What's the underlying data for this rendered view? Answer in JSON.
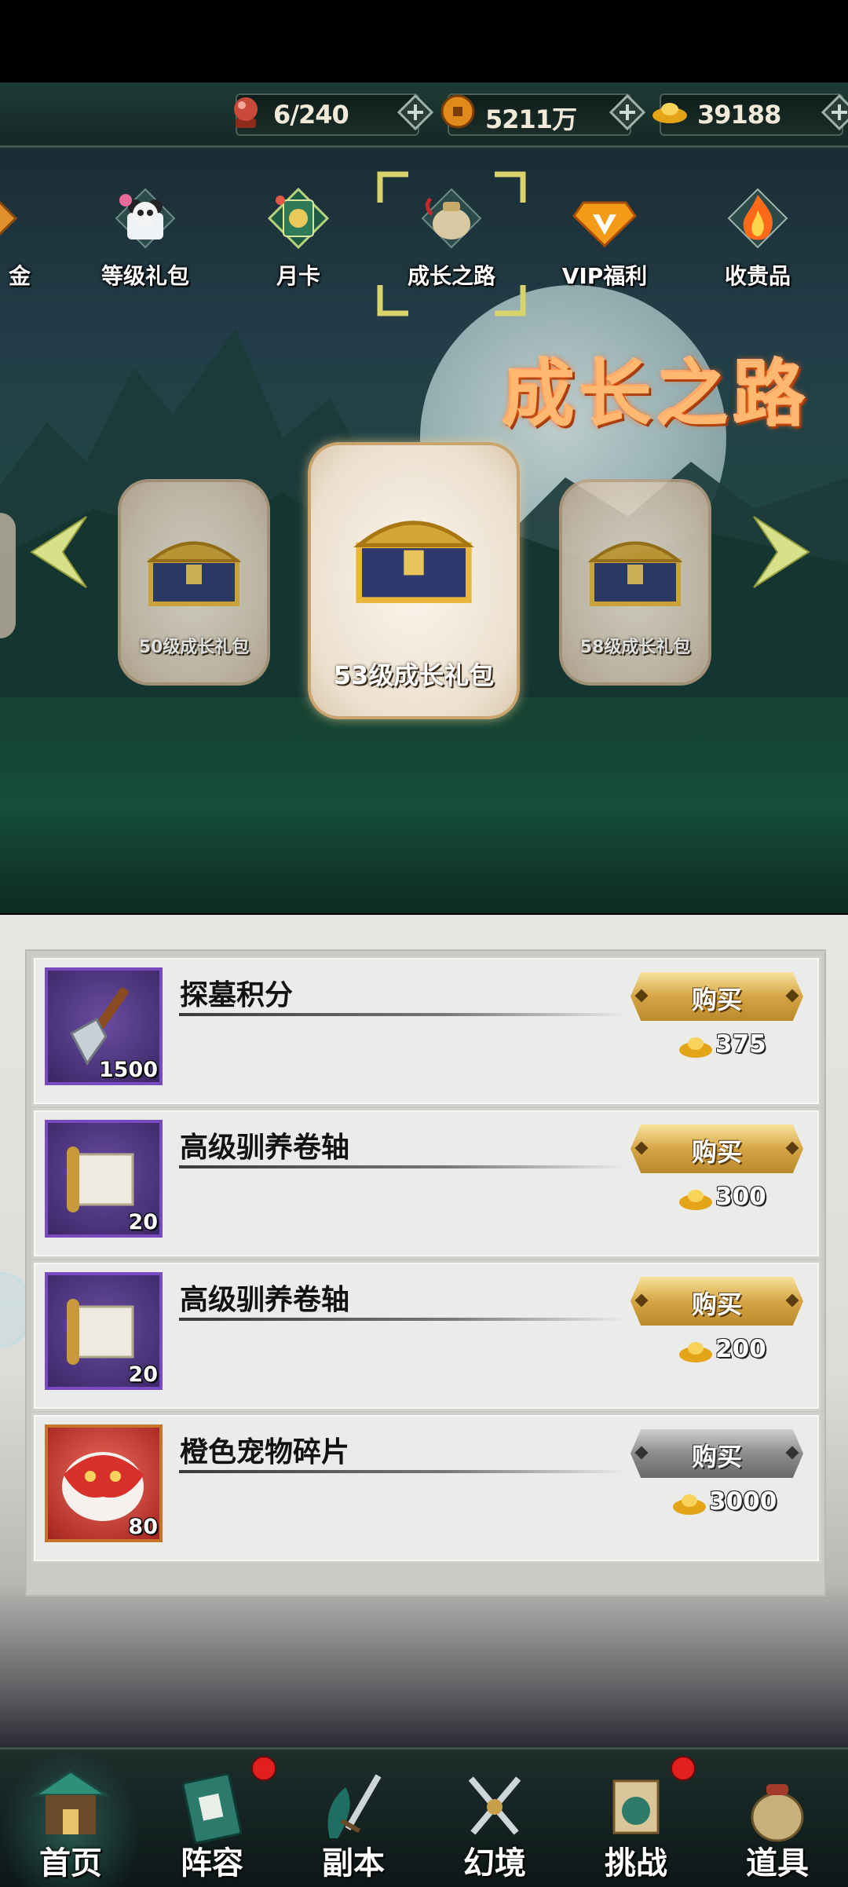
{
  "resources": {
    "stamina": "6/240",
    "copper": "5211万",
    "gold": "39188"
  },
  "tabs": [
    {
      "label": "金",
      "icon": "gold-gift-icon"
    },
    {
      "label": "等级礼包",
      "icon": "level-gift-panda-icon"
    },
    {
      "label": "月卡",
      "icon": "month-card-icon"
    },
    {
      "label": "成长之路",
      "icon": "growth-road-bag-icon",
      "selected": true
    },
    {
      "label": "VIP福利",
      "icon": "vip-gem-icon"
    },
    {
      "label": "收贵品",
      "icon": "collect-treasure-flame-icon"
    }
  ],
  "banner": {
    "title": "成长之路"
  },
  "packs": {
    "left": "50级成长礼包",
    "center": "53级成长礼包",
    "right": "58级成长礼包"
  },
  "shop": {
    "items": [
      {
        "name": "探墓积分",
        "qty": "1500",
        "button": "购买",
        "price": "375",
        "icon": "shovel-icon",
        "button_style": "gold"
      },
      {
        "name": "高级驯养卷轴",
        "qty": "20",
        "button": "购买",
        "price": "300",
        "icon": "scroll-icon",
        "button_style": "gold"
      },
      {
        "name": "高级驯养卷轴",
        "qty": "20",
        "button": "购买",
        "price": "200",
        "icon": "scroll-icon",
        "button_style": "gold"
      },
      {
        "name": "橙色宠物碎片",
        "qty": "80",
        "button": "购买",
        "price": "3000",
        "icon": "pet-fragment-icon",
        "button_style": "gray"
      }
    ]
  },
  "nav": [
    {
      "label": "首页",
      "icon": "home-pavilion-icon",
      "active": true,
      "badge": false
    },
    {
      "label": "阵容",
      "icon": "lineup-book-icon",
      "badge": true
    },
    {
      "label": "副本",
      "icon": "dungeon-sword-icon",
      "badge": false
    },
    {
      "label": "幻境",
      "icon": "illusion-crossed-swords-icon",
      "badge": false
    },
    {
      "label": "挑战",
      "icon": "challenge-scroll-icon",
      "badge": true
    },
    {
      "label": "道具",
      "icon": "items-bag-icon",
      "badge": false
    }
  ],
  "colors": {
    "accent_gold": "#d6a545",
    "title_orange": "#ffb870",
    "rare_purple": "#7a4bc0",
    "legend_orange": "#c6762b",
    "badge_red": "#e21e1e"
  }
}
